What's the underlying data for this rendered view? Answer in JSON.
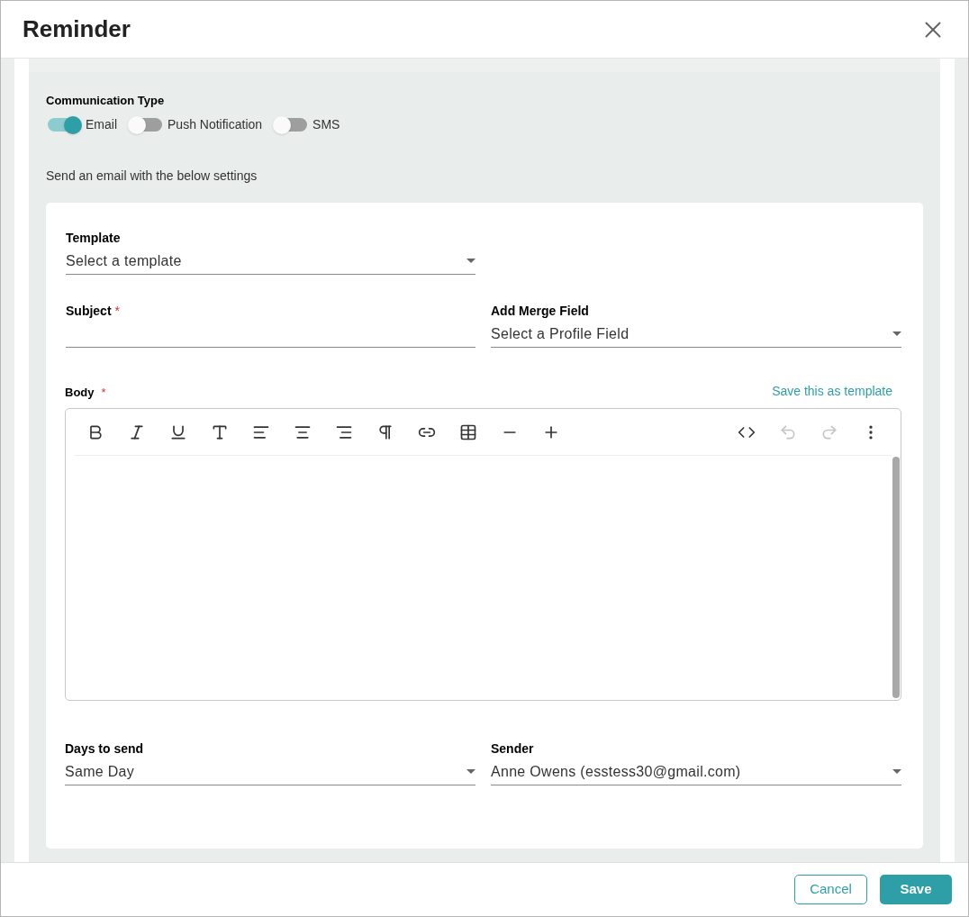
{
  "dialog": {
    "title": "Reminder"
  },
  "communication": {
    "label": "Communication Type",
    "options": [
      {
        "label": "Email",
        "on": true
      },
      {
        "label": "Push Notification",
        "on": false
      },
      {
        "label": "SMS",
        "on": false
      }
    ],
    "description": "Send an email with the below settings"
  },
  "form": {
    "template": {
      "label": "Template",
      "value": "Select a template"
    },
    "subject": {
      "label": "Subject",
      "required_mark": "*"
    },
    "merge_field": {
      "label": "Add Merge Field",
      "value": "Select a Profile Field"
    },
    "body": {
      "label": "Body",
      "required_mark": "*",
      "save_link": "Save this as template",
      "toolbar": [
        {
          "kind": "bold",
          "disabled": false
        },
        {
          "kind": "italic",
          "disabled": false
        },
        {
          "kind": "underline",
          "disabled": false
        },
        {
          "kind": "font",
          "disabled": false
        },
        {
          "kind": "align-left",
          "disabled": false
        },
        {
          "kind": "align-center",
          "disabled": false
        },
        {
          "kind": "align-right",
          "disabled": false
        },
        {
          "kind": "paragraph",
          "disabled": false
        },
        {
          "kind": "link",
          "disabled": false
        },
        {
          "kind": "table",
          "disabled": false
        },
        {
          "kind": "rule",
          "disabled": false
        },
        {
          "kind": "insert",
          "disabled": false
        },
        {
          "kind": "code",
          "disabled": false
        },
        {
          "kind": "undo",
          "disabled": true
        },
        {
          "kind": "redo",
          "disabled": true
        },
        {
          "kind": "more",
          "disabled": false
        }
      ]
    },
    "days_to_send": {
      "label": "Days to send",
      "value": "Same Day"
    },
    "sender": {
      "label": "Sender",
      "value": "Anne Owens (esstess30@gmail.com)"
    }
  },
  "buttons": {
    "cancel": "Cancel",
    "save": "Save"
  }
}
